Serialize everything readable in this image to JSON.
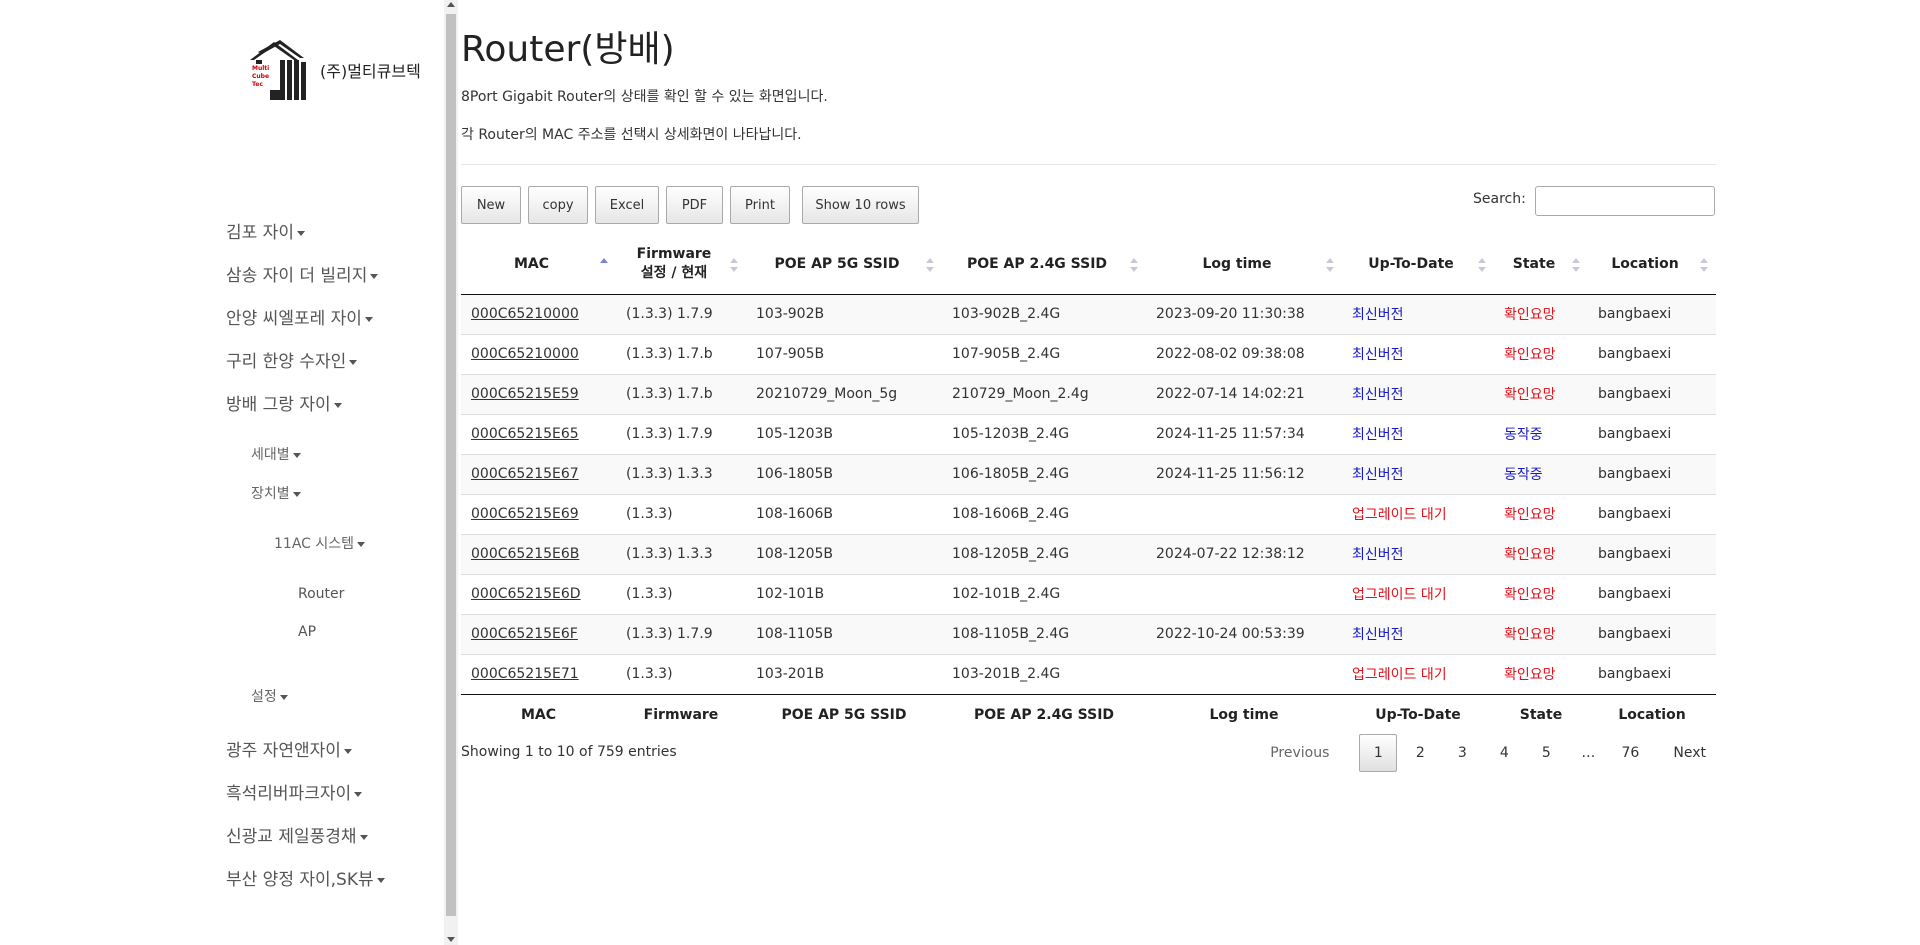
{
  "company": "(주)멀티큐브텍",
  "logo_text": [
    "Multi",
    "Cube",
    "Tec"
  ],
  "sidebar": {
    "items": [
      {
        "label": "김포 자이"
      },
      {
        "label": "삼송 자이 더 빌리지"
      },
      {
        "label": "안양 씨엘포레 자이"
      },
      {
        "label": "구리 한양 수자인"
      },
      {
        "label": "방배 그랑 자이"
      },
      {
        "label": "세대별"
      },
      {
        "label": "장치별"
      },
      {
        "label": "11AC 시스템"
      },
      {
        "label": "Router"
      },
      {
        "label": "AP"
      },
      {
        "label": "설정"
      },
      {
        "label": "광주 자연앤자이"
      },
      {
        "label": "흑석리버파크자이"
      },
      {
        "label": "신광교 제일풍경채"
      },
      {
        "label": "부산 양정 자이,SK뷰"
      }
    ]
  },
  "main": {
    "title": "Router(방배)",
    "desc1": "8Port Gigabit Router의 상태를 확인 할 수 있는 화면입니다.",
    "desc2": "각 Router의 MAC 주소를 선택시 상세화면이 나타납니다."
  },
  "toolbar": {
    "new": "New",
    "copy": "copy",
    "excel": "Excel",
    "pdf": "PDF",
    "print": "Print",
    "show": "Show 10 rows",
    "search_label": "Search:",
    "search_value": ""
  },
  "table": {
    "headers": [
      "MAC",
      "Firmware\n설정 / 현재",
      "POE AP 5G SSID",
      "POE AP 2.4G SSID",
      "Log time",
      "Up-To-Date",
      "State",
      "Location"
    ],
    "footers": [
      "MAC",
      "Firmware",
      "POE AP 5G SSID",
      "POE AP 2.4G SSID",
      "Log time",
      "Up-To-Date",
      "State",
      "Location"
    ],
    "rows": [
      [
        "000C65210000",
        "(1.3.3) 1.7.9",
        "103-902B",
        "103-902B_2.4G",
        "2023-09-20 11:30:38",
        "최신버전",
        "확인요망",
        "bangbaexi"
      ],
      [
        "000C65210000",
        "(1.3.3) 1.7.b",
        "107-905B",
        "107-905B_2.4G",
        "2022-08-02 09:38:08",
        "최신버전",
        "확인요망",
        "bangbaexi"
      ],
      [
        "000C65215E59",
        "(1.3.3) 1.7.b",
        "20210729_Moon_5g",
        "210729_Moon_2.4g",
        "2022-07-14 14:02:21",
        "최신버전",
        "확인요망",
        "bangbaexi"
      ],
      [
        "000C65215E65",
        "(1.3.3) 1.7.9",
        "105-1203B",
        "105-1203B_2.4G",
        "2024-11-25 11:57:34",
        "최신버전",
        "동작중",
        "bangbaexi"
      ],
      [
        "000C65215E67",
        "(1.3.3) 1.3.3",
        "106-1805B",
        "106-1805B_2.4G",
        "2024-11-25 11:56:12",
        "최신버전",
        "동작중",
        "bangbaexi"
      ],
      [
        "000C65215E69",
        "(1.3.3)",
        "108-1606B",
        "108-1606B_2.4G",
        "",
        "업그레이드 대기",
        "확인요망",
        "bangbaexi"
      ],
      [
        "000C65215E6B",
        "(1.3.3) 1.3.3",
        "108-1205B",
        "108-1205B_2.4G",
        "2024-07-22 12:38:12",
        "최신버전",
        "확인요망",
        "bangbaexi"
      ],
      [
        "000C65215E6D",
        "(1.3.3)",
        "102-101B",
        "102-101B_2.4G",
        "",
        "업그레이드 대기",
        "확인요망",
        "bangbaexi"
      ],
      [
        "000C65215E6F",
        "(1.3.3) 1.7.9",
        "108-1105B",
        "108-1105B_2.4G",
        "2022-10-24 00:53:39",
        "최신버전",
        "확인요망",
        "bangbaexi"
      ],
      [
        "000C65215E71",
        "(1.3.3)",
        "103-201B",
        "103-201B_2.4G",
        "",
        "업그레이드 대기",
        "확인요망",
        "bangbaexi"
      ]
    ],
    "status_colors": {
      "최신버전": "#1a1acd",
      "업그레이드 대기": "#e3111b",
      "확인요망": "#e3111b",
      "동작중": "#1a1acd"
    }
  },
  "info": "Showing 1 to 10 of 759 entries",
  "pager": {
    "previous": "Previous",
    "pages": [
      "1",
      "2",
      "3",
      "4",
      "5",
      "…",
      "76"
    ],
    "current": "1",
    "next": "Next"
  }
}
